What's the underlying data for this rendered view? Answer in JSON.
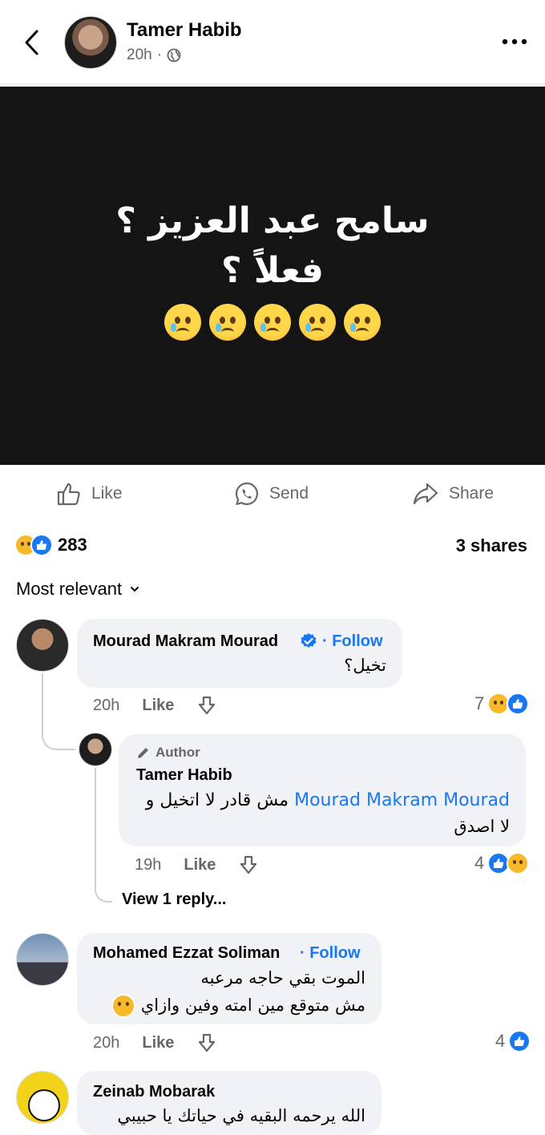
{
  "header": {
    "author": "Tamer Habib",
    "time": "20h",
    "separator": "·"
  },
  "post": {
    "line1": "سامح عبد العزيز ؟",
    "line2": "فعلاً ؟",
    "emoji_name": "crying-face",
    "emoji_count": 5,
    "bg_color": "#141414"
  },
  "actions": {
    "like": "Like",
    "send": "Send",
    "share": "Share"
  },
  "stats": {
    "reactions": "283",
    "shares": "3 shares"
  },
  "sort": {
    "label": "Most relevant"
  },
  "comments": [
    {
      "name": "Mourad Makram Mourad",
      "follow": "· Follow",
      "text": "تخيل؟",
      "time": "20h",
      "like": "Like",
      "reactions": "7"
    },
    {
      "badge": "Author",
      "name": "Tamer Habib",
      "mention": "Mourad Makram Mourad",
      "text_line1": "مش قادر لا اتخيل و",
      "text_line2": "لا اصدق",
      "time": "19h",
      "like": "Like",
      "reactions": "4"
    },
    {
      "view_replies": "View 1 reply..."
    },
    {
      "name": "Mohamed Ezzat Soliman",
      "follow": "· Follow",
      "text_line1": "الموت بقي حاجه مرعبه",
      "text_line2": "مش متوقع مين امته وفين وازاي",
      "time": "20h",
      "like": "Like",
      "reactions": "4"
    },
    {
      "name": "Zeinab Mobarak",
      "text": "الله يرحمه البقيه في حياتك يا حبيبي"
    }
  ],
  "colors": {
    "accent": "#1877f2",
    "muted": "#65676b",
    "bubble": "#f0f2f5"
  }
}
